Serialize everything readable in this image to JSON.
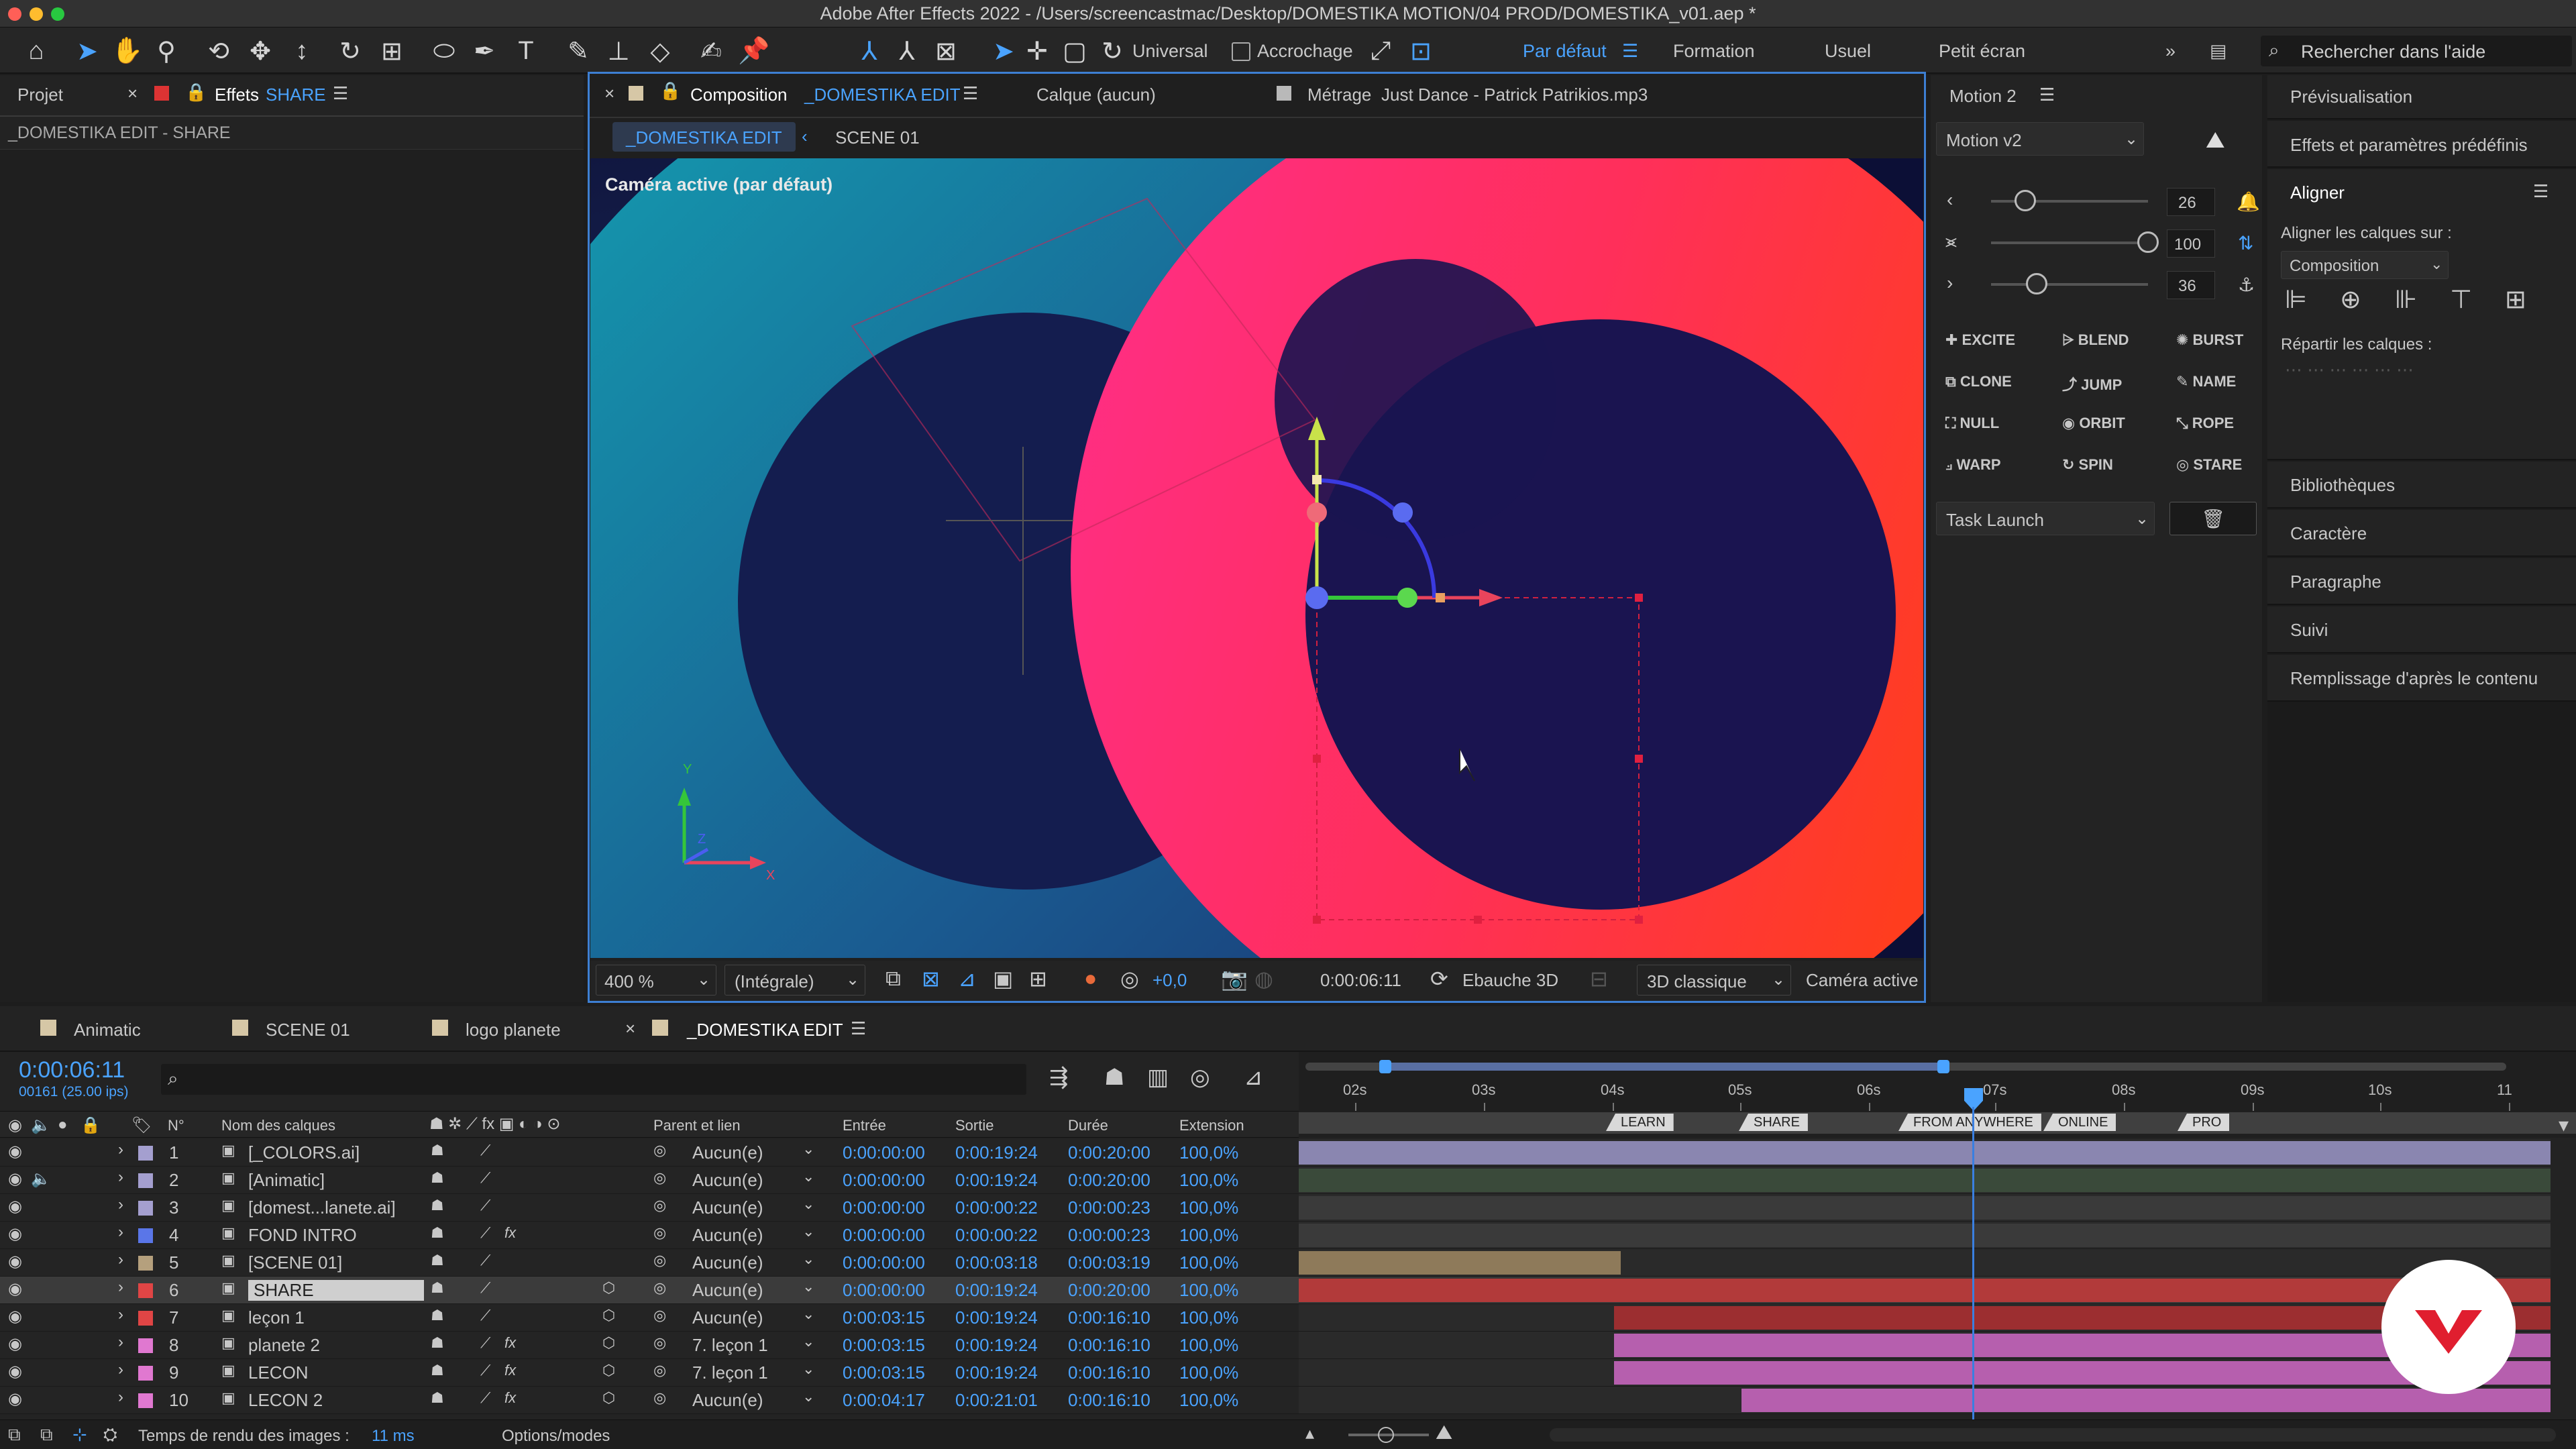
{
  "window": {
    "title": "Adobe After Effects 2022 - /Users/screencastmac/Desktop/DOMESTIKA MOTION/04 PROD/DOMESTIKA_v01.aep *"
  },
  "toolbar": {
    "universal": "Universal",
    "snap": "Accrochage",
    "workspaces": [
      "Par défaut",
      "Formation",
      "Usuel",
      "Petit écran"
    ],
    "search_placeholder": "Rechercher dans l'aide"
  },
  "left_panel": {
    "tab_project": "Projet",
    "tab_effects": "Effets",
    "tab_effects_target": "SHARE",
    "breadcrumb": "_DOMESTIKA EDIT - SHARE"
  },
  "composition": {
    "tab_label": "Composition",
    "tab_name": "_DOMESTIKA EDIT",
    "layer_tab": "Calque (aucun)",
    "footage_label": "Métrage",
    "footage_name": "Just Dance - Patrick Patrikios.mp3",
    "nav": [
      "_DOMESTIKA EDIT",
      "SCENE 01"
    ],
    "camera_label": "Caméra active (par défaut)"
  },
  "viewer_footer": {
    "zoom": "400 %",
    "resolution": "(Intégrale)",
    "exposure": "+0,0",
    "timecode": "0:00:06:11",
    "draft": "Ebauche 3D",
    "renderer": "3D classique",
    "camera": "Caméra active"
  },
  "motion": {
    "title": "Motion 2",
    "dropdown": "Motion v2",
    "sliders": [
      {
        "value": "26",
        "level": 0.22
      },
      {
        "value": "100",
        "level": 1.0
      },
      {
        "value": "36",
        "level": 0.29
      }
    ],
    "buttons": [
      "EXCITE",
      "BLEND",
      "BURST",
      "CLONE",
      "JUMP",
      "NAME",
      "NULL",
      "ORBIT",
      "ROPE",
      "WARP",
      "SPIN",
      "STARE"
    ],
    "task": "Task Launch"
  },
  "right_panel": {
    "items_top": [
      "Prévisualisation",
      "Effets et paramètres prédéfinis"
    ],
    "align_title": "Aligner",
    "align_on_label": "Aligner les calques sur :",
    "align_on_value": "Composition",
    "distribute_label": "Répartir les calques :",
    "items_bottom": [
      "Bibliothèques",
      "Caractère",
      "Paragraphe",
      "Suivi",
      "Remplissage d'après le contenu"
    ]
  },
  "timeline": {
    "tabs": [
      "Animatic",
      "SCENE 01",
      "logo planete",
      "_DOMESTIKA EDIT"
    ],
    "timecode": "0:00:06:11",
    "frames": "00161 (25.00 ips)",
    "search_placeholder": "",
    "col_headers": {
      "n": "N°",
      "name": "Nom des calques",
      "parent": "Parent et lien",
      "in": "Entrée",
      "out": "Sortie",
      "dur": "Durée",
      "ext": "Extension"
    },
    "ruler": [
      "02s",
      "03s",
      "04s",
      "05s",
      "06s",
      "07s",
      "08s",
      "09s",
      "10s",
      "11"
    ],
    "markers": [
      "LEARN",
      "SHARE",
      "FROM ANYWHERE",
      "ONLINE",
      "PRO"
    ],
    "layers": [
      {
        "n": "1",
        "name": "[_COLORS.ai]",
        "color": "#a49fcf",
        "parent": "Aucun(e)",
        "in": "0:00:00:00",
        "out": "0:00:19:24",
        "dur": "0:00:20:00",
        "ext": "100,0%"
      },
      {
        "n": "2",
        "name": "[Animatic]",
        "color": "#a49fcf",
        "parent": "Aucun(e)",
        "in": "0:00:00:00",
        "out": "0:00:19:24",
        "dur": "0:00:20:00",
        "ext": "100,0%"
      },
      {
        "n": "3",
        "name": "[domest...lanete.ai]",
        "color": "#a49fcf",
        "parent": "Aucun(e)",
        "in": "0:00:00:00",
        "out": "0:00:00:22",
        "dur": "0:00:00:23",
        "ext": "100,0%"
      },
      {
        "n": "4",
        "name": "FOND INTRO",
        "color": "#5a76e8",
        "parent": "Aucun(e)",
        "in": "0:00:00:00",
        "out": "0:00:00:22",
        "dur": "0:00:00:23",
        "ext": "100,0%"
      },
      {
        "n": "5",
        "name": "[SCENE 01]",
        "color": "#b5a07d",
        "parent": "Aucun(e)",
        "in": "0:00:00:00",
        "out": "0:00:03:18",
        "dur": "0:00:03:19",
        "ext": "100,0%"
      },
      {
        "n": "6",
        "name": "SHARE",
        "color": "#e04545",
        "parent": "Aucun(e)",
        "in": "0:00:00:00",
        "out": "0:00:19:24",
        "dur": "0:00:20:00",
        "ext": "100,0%"
      },
      {
        "n": "7",
        "name": "leçon 1",
        "color": "#e04545",
        "parent": "Aucun(e)",
        "in": "0:00:03:15",
        "out": "0:00:19:24",
        "dur": "0:00:16:10",
        "ext": "100,0%"
      },
      {
        "n": "8",
        "name": "planete 2",
        "color": "#e078d0",
        "parent": "7. leçon 1",
        "in": "0:00:03:15",
        "out": "0:00:19:24",
        "dur": "0:00:16:10",
        "ext": "100,0%"
      },
      {
        "n": "9",
        "name": "LECON",
        "color": "#e078d0",
        "parent": "7. leçon 1",
        "in": "0:00:03:15",
        "out": "0:00:19:24",
        "dur": "0:00:16:10",
        "ext": "100,0%"
      },
      {
        "n": "10",
        "name": "LECON 2",
        "color": "#e078d0",
        "parent": "Aucun(e)",
        "in": "0:00:04:17",
        "out": "0:00:21:01",
        "dur": "0:00:16:10",
        "ext": "100,0%"
      }
    ]
  },
  "status": {
    "render_label": "Temps de rendu des images :",
    "render_value": "11 ms",
    "options": "Options/modes"
  }
}
